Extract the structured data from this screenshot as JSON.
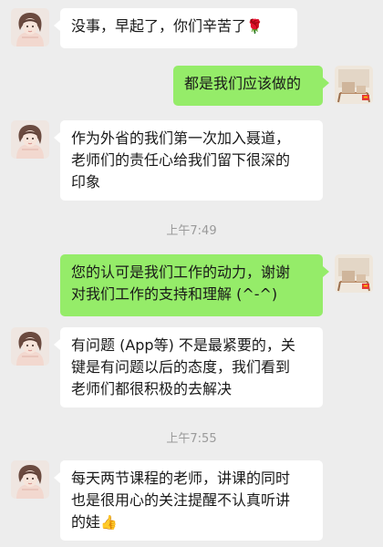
{
  "messages": [
    {
      "side": "left",
      "lines": [
        "没事，早起了，你们辛苦了"
      ],
      "emoji": "🌹"
    },
    {
      "side": "right",
      "lines": [
        "都是我们应该做的"
      ]
    },
    {
      "side": "left",
      "lines": [
        "作为外省的我们第一次加入聂道，",
        "老师们的责任心给我们留下很深的",
        "印象"
      ]
    },
    {
      "side": "time",
      "text": "上午7:49"
    },
    {
      "side": "right",
      "lines": [
        "您的认可是我们工作的动力，谢谢",
        "对我们工作的支持和理解 (^-^)"
      ]
    },
    {
      "side": "left",
      "lines": [
        "有问题 (App等) 不是最紧要的，关",
        "键是有问题以后的态度，我们看到",
        "老师们都很积极的去解决"
      ]
    },
    {
      "side": "time",
      "text": "上午7:55"
    },
    {
      "side": "left",
      "lines": [
        "每天两节课程的老师，讲课的同时",
        "也是很用心的关注提醒不认真听讲",
        "的娃"
      ],
      "emoji": "👍"
    }
  ],
  "colors": {
    "background": "#ededed",
    "bubble_left": "#ffffff",
    "bubble_right": "#95ec69",
    "timestamp": "#9a9a9a"
  },
  "icons": {
    "left_avatar": "girl-portrait-avatar",
    "right_avatar": "wooden-desk-avatar"
  }
}
